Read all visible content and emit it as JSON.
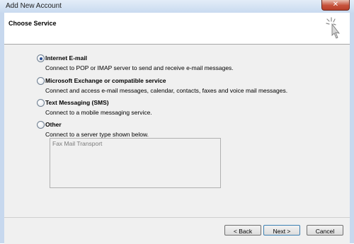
{
  "window": {
    "title": "Add New Account",
    "close_glyph": "✕"
  },
  "header": {
    "title": "Choose Service",
    "icon": "wizard-sparkle-icon"
  },
  "options": [
    {
      "label": "Internet E-mail",
      "description": "Connect to POP or IMAP server to send and receive e-mail messages.",
      "selected": true
    },
    {
      "label": "Microsoft Exchange or compatible service",
      "description": "Connect and access e-mail messages, calendar, contacts, faxes and voice mail messages.",
      "selected": false
    },
    {
      "label": "Text Messaging (SMS)",
      "description": "Connect to a mobile messaging service.",
      "selected": false
    },
    {
      "label": "Other",
      "description": "Connect to a server type shown below.",
      "selected": false
    }
  ],
  "other_list": {
    "items": [
      "Fax Mail Transport"
    ]
  },
  "buttons": {
    "back": "< Back",
    "next": "Next >",
    "cancel": "Cancel"
  }
}
